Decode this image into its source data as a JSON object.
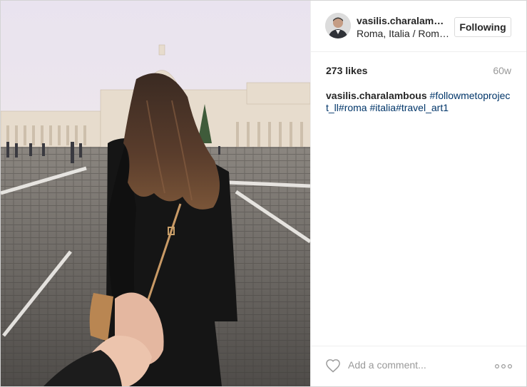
{
  "post": {
    "username": "vasilis.charalambous",
    "location": "Roma, Italia / Roma, Italy",
    "follow_label": "Following",
    "likes": "273 likes",
    "age": "60w",
    "caption": {
      "username": "vasilis.charalambous",
      "tags": [
        " #followmetoproject_ll",
        "#roma",
        " #italia",
        "#travel_art1"
      ]
    },
    "comment_placeholder": "Add a comment..."
  },
  "icons": {
    "heart": "heart-icon",
    "more": "more-options-icon"
  },
  "colors": {
    "hashtag": "#003569",
    "muted": "#999999",
    "text": "#262626"
  }
}
